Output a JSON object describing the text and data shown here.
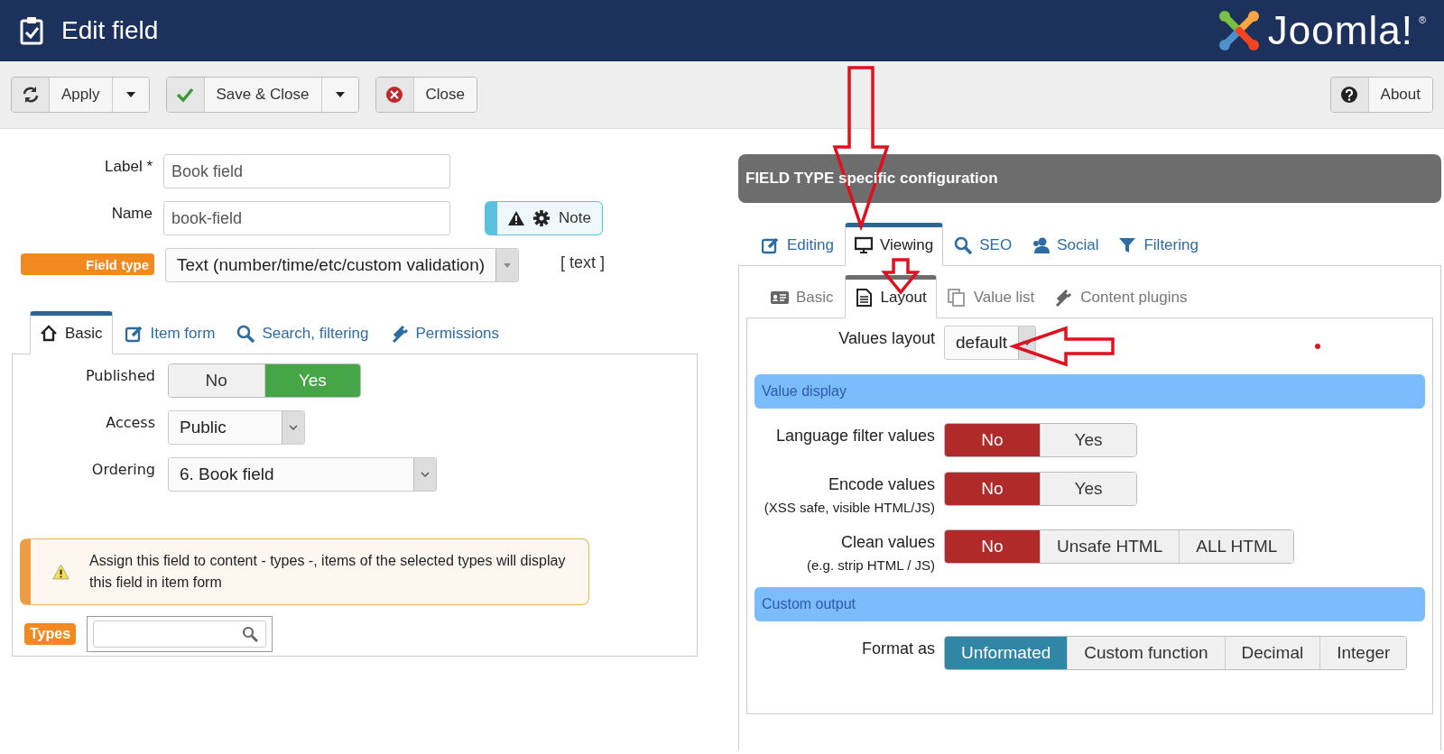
{
  "header": {
    "title": "Edit field",
    "logo_text": "Joomla!",
    "logo_mark": "®"
  },
  "toolbar": {
    "groups": [
      {
        "label": "Apply",
        "dropdown": true
      },
      {
        "label": "Save & Close",
        "dropdown": true
      },
      {
        "label": "Close",
        "dropdown": false
      }
    ],
    "help": {
      "label": "About"
    }
  },
  "form": {
    "label": {
      "label": "Label *",
      "value": "Book field"
    },
    "name": {
      "label": "Name",
      "value": "book-field"
    },
    "note": {
      "label": "Note"
    },
    "field_type": {
      "label": "Field type",
      "value": "Text (number/time/etc/custom validation)",
      "code": "[ text ]"
    }
  },
  "left_tabs": [
    {
      "label": "Basic",
      "selected": true
    },
    {
      "label": "Item form",
      "selected": false
    },
    {
      "label": "Search, filtering",
      "selected": false
    },
    {
      "label": "Permissions",
      "selected": false
    }
  ],
  "basic": {
    "published": {
      "label": "Published",
      "color": "#46a546",
      "options": [
        {
          "label": "No",
          "selected": false
        },
        {
          "label": "Yes",
          "selected": true
        }
      ]
    },
    "access": {
      "label": "Access",
      "value": "Public"
    },
    "ordering": {
      "label": "Ordering",
      "value": "6. Book field"
    },
    "alert": "Assign this field to content - types -, items of the selected types will display this field in item form",
    "types": {
      "label": "Types"
    }
  },
  "config": {
    "title": "FIELD TYPE specific configuration",
    "tabs": [
      {
        "label": "Editing",
        "selected": false
      },
      {
        "label": "Viewing",
        "selected": true
      },
      {
        "label": "SEO",
        "selected": false
      },
      {
        "label": "Social",
        "selected": false
      },
      {
        "label": "Filtering",
        "selected": false
      }
    ],
    "subtabs": [
      {
        "label": "Basic",
        "selected": false
      },
      {
        "label": "Layout",
        "selected": true
      },
      {
        "label": "Value list",
        "selected": false
      },
      {
        "label": "Content plugins",
        "selected": false
      }
    ],
    "values_layout": {
      "label": "Values layout",
      "value": "default"
    },
    "sections": [
      {
        "title": "Value display",
        "rows": [
          {
            "label": "Language filter values",
            "color": "#b02a2a",
            "options": [
              {
                "label": "No",
                "selected": true
              },
              {
                "label": "Yes",
                "selected": false
              }
            ]
          },
          {
            "label": "Encode values",
            "hint": "(XSS safe, visible HTML/JS)",
            "color": "#b02a2a",
            "options": [
              {
                "label": "No",
                "selected": true
              },
              {
                "label": "Yes",
                "selected": false
              }
            ]
          },
          {
            "label": "Clean values",
            "hint": "(e.g. strip HTML / JS)",
            "color": "#b02a2a",
            "options": [
              {
                "label": "No",
                "selected": true
              },
              {
                "label": "Unsafe HTML",
                "selected": false
              },
              {
                "label": "ALL HTML",
                "selected": false
              }
            ]
          }
        ]
      },
      {
        "title": "Custom output",
        "rows": [
          {
            "label": "Format as",
            "color": "#2f87a5",
            "options": [
              {
                "label": "Unformated",
                "selected": true
              },
              {
                "label": "Custom function",
                "selected": false
              },
              {
                "label": "Decimal",
                "selected": false
              },
              {
                "label": "Integer",
                "selected": false
              }
            ]
          }
        ]
      }
    ]
  }
}
